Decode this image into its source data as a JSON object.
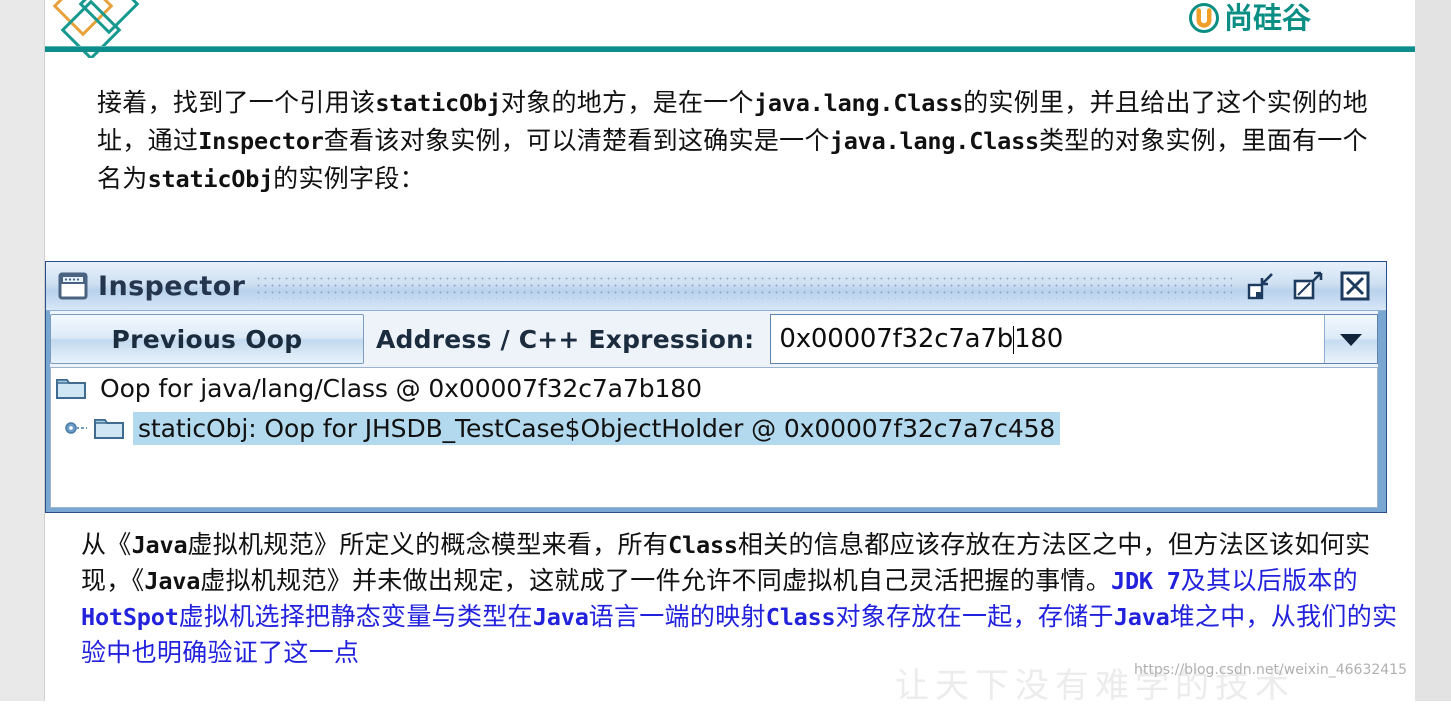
{
  "header": {
    "brand_name": "尚硅谷",
    "brand_color": "#0b8f84",
    "accent_color": "#0d8c8c",
    "diamond_colors": [
      "#e8a23c",
      "#17998f"
    ]
  },
  "top_text": {
    "line1_a": "接着，找到了一个引用该",
    "line1_mono1": "staticObj",
    "line1_b": "对象的地方，是在一个",
    "line1_mono2": "java.lang.Class",
    "line1_c": "的实例里，并且",
    "line2_a": "给出了这个实例的地址，通过",
    "line2_mono1": "Inspector",
    "line2_b": "查看该对象实例，可以清楚看到这确实是一个",
    "line3_mono1": "java.lang.Class",
    "line3_a": "类型的对象实例，里面有一个名为",
    "line3_mono2": "staticObj",
    "line3_b": "的实例字段："
  },
  "inspector": {
    "window_title": "Inspector",
    "window_icon": "window-frame-icon",
    "buttons": {
      "minimize": "minimize-icon",
      "maximize": "maximize-icon",
      "close": "close-icon"
    },
    "toolbar": {
      "previous_oop_label": "Previous Oop",
      "address_label": "Address / C++ Expression:",
      "address_value_before_caret": "0x00007f32c7a7b",
      "address_value_after_caret": "180",
      "address_value_full": "0x00007f32c7a7b180",
      "dropdown_icon": "chevron-down-icon"
    },
    "tree": [
      {
        "icon": "folder-icon",
        "label": "Oop for java/lang/Class @ 0x00007f32c7a7b180",
        "selected": false,
        "has_expander": false,
        "level": 0
      },
      {
        "icon": "folder-icon",
        "expander": "expand-handle-icon",
        "label": "staticObj: Oop for JHSDB_TestCase$ObjectHolder @ 0x00007f32c7a7c458",
        "selected": true,
        "has_expander": true,
        "level": 1
      }
    ],
    "selection_color": "#b3d9ee"
  },
  "bottom_text": {
    "line1_a": "从《",
    "line1_mono1": "Java",
    "line1_b": "虚拟机规范》所定义的概念模型来看，所有",
    "line1_mono2": "Class",
    "line1_c": "相关的信息都应该存放在方法区之中，",
    "line2_a": "但方法区该如何实现，《",
    "line2_mono1": "Java",
    "line2_b": "虚拟机规范》并未做出规定，这就成了一件允许不同虚拟机自己",
    "line3_a": "灵活把握的事情。",
    "line3_blue_mono1": "JDK 7",
    "line3_blue_a": "及其以后版本的",
    "line3_blue_mono2": "HotSpot",
    "line3_blue_b": "虚拟机选择把静态变量与类型在",
    "line3_blue_mono3": "Java",
    "line3_blue_c": "语言一端",
    "line4_blue_a": "的映射",
    "line4_blue_mono1": "Class",
    "line4_blue_b": "对象存放在一起，存储于",
    "line4_blue_mono2": "Java",
    "line4_blue_c": "堆之中，从我们的实验中也明确验证了这一点",
    "blue_color": "#2222dd"
  },
  "watermarks": {
    "url": "https://blog.csdn.net/weixin_46632415",
    "cn": "让天下没有难学的技术"
  }
}
